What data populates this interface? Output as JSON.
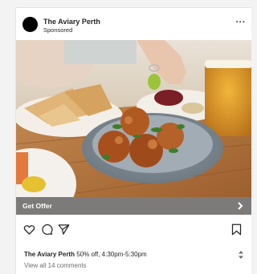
{
  "post": {
    "account_name": "The Aviary Perth",
    "sponsored_label": "Sponsored",
    "more_icon": "more-dots-icon",
    "cta_label": "Get Offer",
    "caption_account": "The Aviary Perth",
    "caption_text": "50% off, 4:30pm-5:30pm",
    "comments_link": "View all 14 comments"
  },
  "photo": {
    "subject": "plate of fried croquettes with herbs, flatbread, beer on wooden table"
  },
  "actions": {
    "like_icon": "heart-icon",
    "comment_icon": "comment-bubble-icon",
    "share_icon": "send-icon",
    "save_icon": "bookmark-icon"
  },
  "colors": {
    "cta_bar": "#7d7b79",
    "text": "#262626",
    "muted": "#6e6e6e",
    "background": "#f3f3f3"
  }
}
